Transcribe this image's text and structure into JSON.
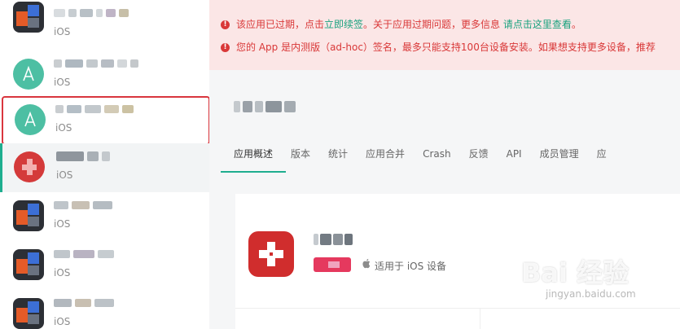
{
  "sidebar": {
    "apps": [
      {
        "platform": "iOS"
      },
      {
        "platform": "iOS"
      },
      {
        "platform": "iOS"
      },
      {
        "platform": "iOS"
      },
      {
        "platform": "iOS"
      },
      {
        "platform": "iOS"
      },
      {
        "platform": "iOS"
      }
    ]
  },
  "notices": [
    {
      "text": "该应用已过期，点击",
      "link": "立即续签",
      "text2": "。关于应用过期问题，更多信息 ",
      "link2": "请点击这里查看",
      "text3": "。"
    },
    {
      "text": "您的 App 是内测版（ad-hoc）签名，最多只能支持100台设备安装。如果想支持更多设备，推荐"
    }
  ],
  "tabs": [
    "应用概述",
    "版本",
    "统计",
    "应用合并",
    "Crash",
    "反馈",
    "API",
    "成员管理",
    "应"
  ],
  "detail": {
    "platform_label": "适用于 iOS 设备"
  },
  "watermark": {
    "big": "Bai 经验",
    "small": "jingyan.baidu.com"
  },
  "colors": {
    "accent": "#1fae8f",
    "warning": "#d93838",
    "highlight_border": "#d9363e"
  }
}
